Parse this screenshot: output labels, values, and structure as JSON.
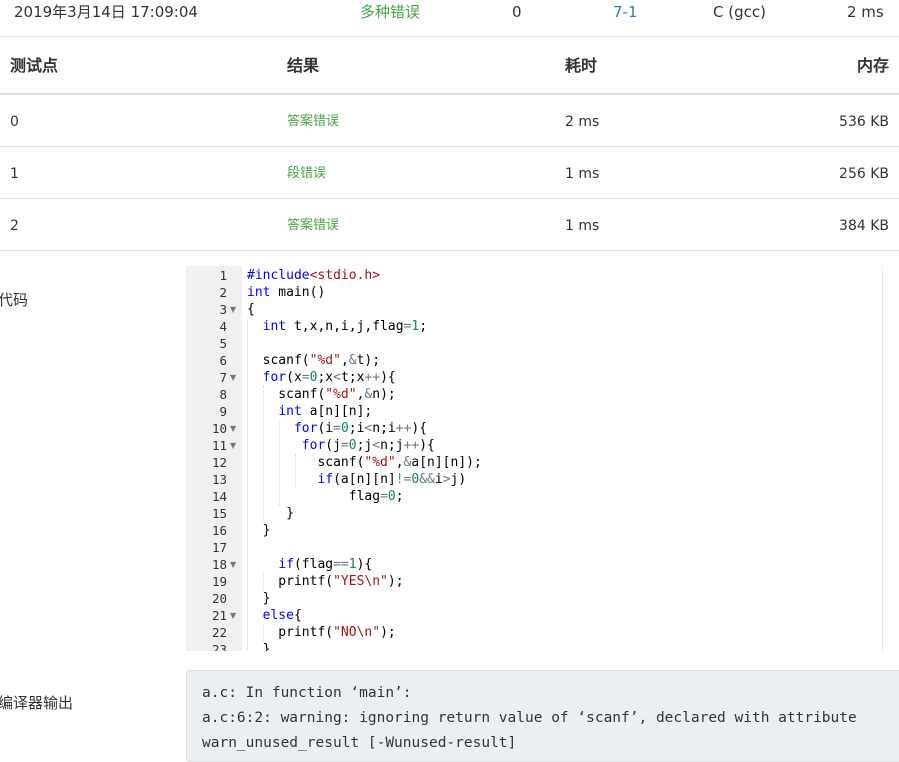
{
  "submission": {
    "time": "2019年3月14日 17:09:04",
    "status": "多种错误",
    "score": "0",
    "problem": "7-1",
    "compiler": "C (gcc)",
    "duration": "2 ms"
  },
  "test_table": {
    "headers": [
      "测试点",
      "结果",
      "耗时",
      "内存"
    ],
    "rows": [
      {
        "point": "0",
        "result": "答案错误",
        "time": "2 ms",
        "memory": "536 KB"
      },
      {
        "point": "1",
        "result": "段错误",
        "time": "1 ms",
        "memory": "256 KB"
      },
      {
        "point": "2",
        "result": "答案错误",
        "time": "1 ms",
        "memory": "384 KB"
      }
    ]
  },
  "code_section": {
    "label": "代码",
    "line_numbers": [
      "1",
      "2",
      "3",
      "4",
      "5",
      "6",
      "7",
      "8",
      "9",
      "10",
      "11",
      "12",
      "13",
      "14",
      "15",
      "16",
      "17",
      "18",
      "19",
      "20",
      "21",
      "22",
      "23"
    ]
  },
  "compiler_section": {
    "label": "编译器输出",
    "output_lines": [
      "a.c: In function ‘main’:",
      "a.c:6:2: warning: ignoring return value of ‘scanf’, declared with attribute",
      "warn_unused_result [-Wunused-result]"
    ]
  },
  "colors": {
    "status_green": "#47a447",
    "link_blue": "#337ab7",
    "keyword": "#0000ff",
    "string": "#a31515",
    "number": "#09885a"
  }
}
